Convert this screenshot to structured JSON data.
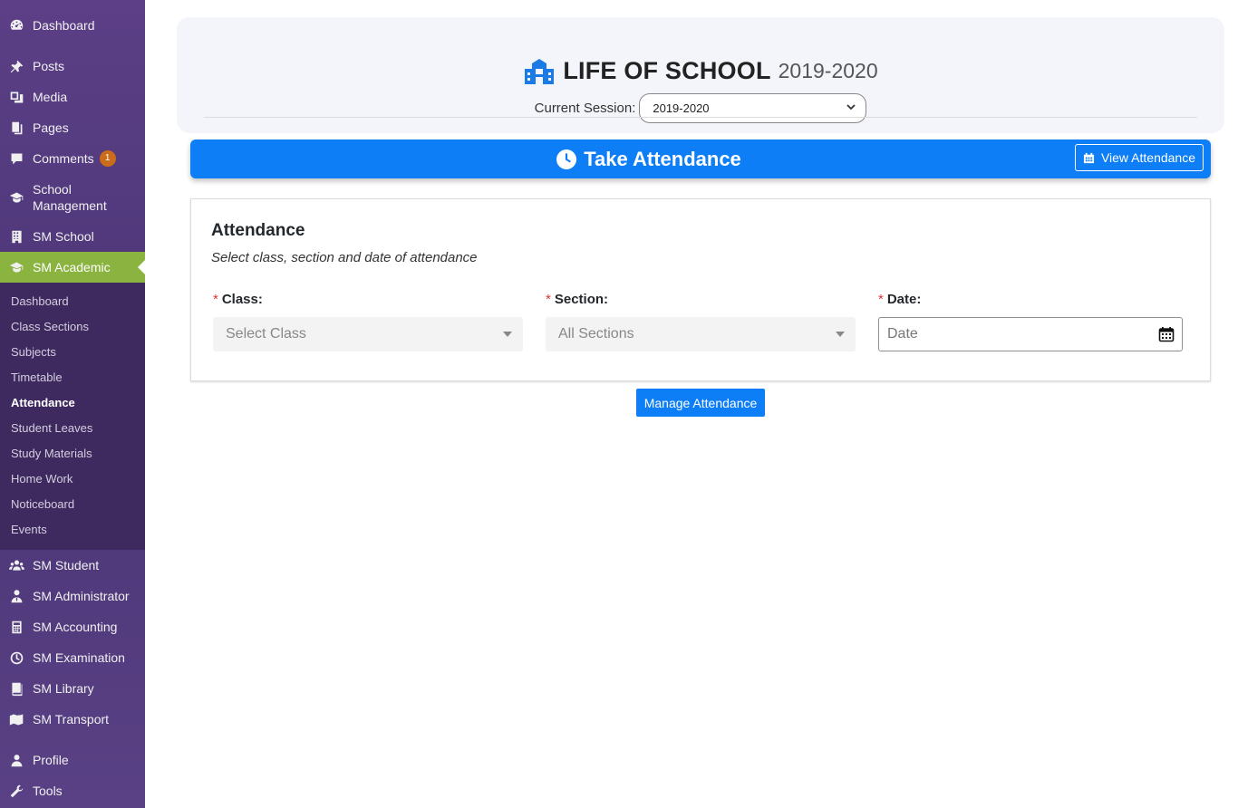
{
  "sidebar": {
    "items": [
      {
        "label": "Dashboard",
        "icon": "dashboard-icon"
      },
      {
        "label": "Posts",
        "icon": "pin-icon"
      },
      {
        "label": "Media",
        "icon": "media-icon"
      },
      {
        "label": "Pages",
        "icon": "pages-icon"
      },
      {
        "label": "Comments",
        "icon": "comment-icon",
        "badge": "1"
      },
      {
        "label": "School Management",
        "icon": "graduation-cap-icon"
      },
      {
        "label": "SM School",
        "icon": "building-icon"
      },
      {
        "label": "SM Academic",
        "icon": "graduation-cap-icon"
      },
      {
        "label": "SM Student",
        "icon": "users-icon"
      },
      {
        "label": "SM Administrator",
        "icon": "user-tie-icon"
      },
      {
        "label": "SM Accounting",
        "icon": "calculator-icon"
      },
      {
        "label": "SM Examination",
        "icon": "clock-icon"
      },
      {
        "label": "SM Library",
        "icon": "book-icon"
      },
      {
        "label": "SM Transport",
        "icon": "map-icon"
      },
      {
        "label": "Profile",
        "icon": "user-icon"
      },
      {
        "label": "Tools",
        "icon": "wrench-icon"
      }
    ],
    "submenu": [
      "Dashboard",
      "Class Sections",
      "Subjects",
      "Timetable",
      "Attendance",
      "Student Leaves",
      "Study Materials",
      "Home Work",
      "Noticeboard",
      "Events"
    ],
    "active_submenu": "Attendance"
  },
  "header": {
    "school_name": "LIFE OF SCHOOL",
    "school_year": "2019-2020",
    "session_label": "Current Session:",
    "session_value": "2019-2020"
  },
  "attendance_bar": {
    "title": "Take Attendance",
    "view_button": "View Attendance"
  },
  "form": {
    "title": "Attendance",
    "subtitle": "Select class, section and date of attendance",
    "required_mark": "*",
    "class_label": "Class:",
    "class_placeholder": "Select Class",
    "section_label": "Section:",
    "section_placeholder": "All Sections",
    "date_label": "Date:",
    "date_placeholder": "Date"
  },
  "manage_button": "Manage Attendance",
  "colors": {
    "sidebar": "#4a3576",
    "active_menu": "#8ab33f",
    "primary": "#0d7ef5",
    "required": "#d63638"
  }
}
